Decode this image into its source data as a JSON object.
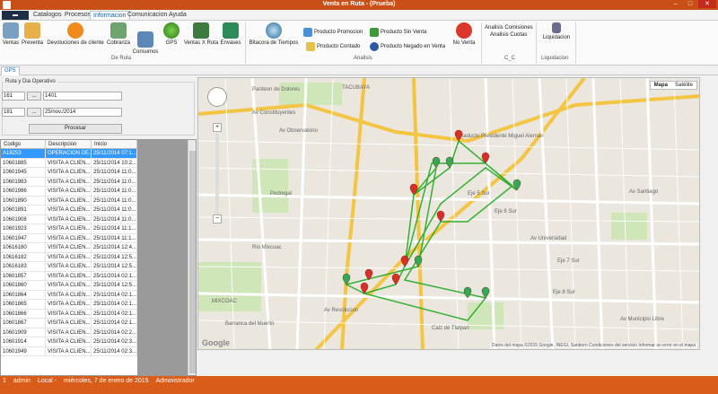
{
  "window": {
    "title": "Venta en Ruta - (Prueba)"
  },
  "menu": {
    "items": [
      "Catalogos",
      "Procesos",
      "Informacion",
      "Comunicacion",
      "Ayuda"
    ],
    "active": "Informacion"
  },
  "ribbon": {
    "ruta_buttons": [
      "Ventas",
      "Preventa",
      "Devoluciones de cliente",
      "Cobranza",
      "Consumos",
      "GPS",
      "Ventas X Ruta",
      "Envases"
    ],
    "ruta_group": "De Ruta",
    "analisis": {
      "bitacora": "Bitacora de Tiempos",
      "promocion": "Producto Promocion",
      "contado": "Producto Contado",
      "sin_venta": "Producto Sin Venta",
      "negado": "Producto Negado en Venta",
      "no_venta": "No Venta",
      "group": "Analisis"
    },
    "cc": {
      "comisiones": "Analisis Comisiones",
      "cuotas": "Analisis Cuotas",
      "group": "C_C"
    },
    "liq": {
      "label": "Liquidacion",
      "group": "Liquidacion"
    }
  },
  "tab": "GPS",
  "filters": {
    "group_title": "Ruta y Dia Operativo",
    "ruta_code": "161",
    "ruta_value": "1401",
    "dia_code": "181",
    "dia_value": "25/nov./2014",
    "ellipsis": "...",
    "process_button": "Procesar"
  },
  "grid": {
    "headers": [
      "Codigo",
      "Descripcion",
      "Inicio"
    ],
    "rows": [
      [
        "A18253",
        "OPERACION DE...",
        "25/11/2014 07:1..."
      ],
      [
        "10601885",
        "VISITA A CLIEN...",
        "25/11/2014 10:2..."
      ],
      [
        "10601945",
        "VISITA A CLIEN...",
        "25/11/2014 11:0..."
      ],
      [
        "10601983",
        "VISITA A CLIEN...",
        "25/11/2014 11:0..."
      ],
      [
        "10601986",
        "VISITA A CLIEN...",
        "25/11/2014 11:0..."
      ],
      [
        "10601890",
        "VISITA A CLIEN...",
        "25/11/2014 11:0..."
      ],
      [
        "10601891",
        "VISITA A CLIEN...",
        "25/11/2014 11:0..."
      ],
      [
        "10601908",
        "VISITA A CLIEN...",
        "25/11/2014 11:0..."
      ],
      [
        "10601923",
        "VISITA A CLIEN...",
        "25/11/2014 11:1..."
      ],
      [
        "10601947",
        "VISITA A CLIEN...",
        "25/11/2014 11:1..."
      ],
      [
        "10616180",
        "VISITA A CLIEN...",
        "25/11/2014 12:4..."
      ],
      [
        "10616182",
        "VISITA A CLIEN...",
        "25/11/2014 12:5..."
      ],
      [
        "10616183",
        "VISITA A CLIEN...",
        "25/11/2014 12:5..."
      ],
      [
        "10601857",
        "VISITA A CLIEN...",
        "25/11/2014 02:1..."
      ],
      [
        "10601860",
        "VISITA A CLIEN...",
        "25/11/2014 12:5..."
      ],
      [
        "10601864",
        "VISITA A CLIEN...",
        "25/11/2014 02:1..."
      ],
      [
        "10601865",
        "VISITA A CLIEN...",
        "25/11/2014 02:1..."
      ],
      [
        "10601866",
        "VISITA A CLIEN...",
        "25/11/2014 02:1..."
      ],
      [
        "10601867",
        "VISITA A CLIEN...",
        "25/11/2014 02:1..."
      ],
      [
        "10601909",
        "VISITA A CLIEN...",
        "25/11/2014 02:2..."
      ],
      [
        "10601914",
        "VISITA A CLIEN...",
        "25/11/2014 02:3..."
      ],
      [
        "10601949",
        "VISITA A CLIEN...",
        "25/11/2014 02:3..."
      ]
    ]
  },
  "map": {
    "type_buttons": [
      "Mapa",
      "Satélite"
    ],
    "copyright": "Datos del mapa ©2015 Google, INEGI, Sanborn   Condiciones del servicio   Informar un error en el mapa",
    "google": "Google",
    "streets": [
      "Panteon de Dolores",
      "TACUBAYA",
      "Av Constituyentes",
      "Av Observatorio",
      "Viaducto Presidente Miguel Aleman",
      "Eje 5 Sur",
      "Eje 6 Sur",
      "Av Santiago",
      "Eje 7 Sur",
      "Av Municipio Libre",
      "Rio Mixcoac",
      "MIXCOAC",
      "Barranca del Muerto",
      "Av Revolucion",
      "Pedregal",
      "Av Universidad",
      "Eje 8 Sur",
      "Calz de Tlalpan"
    ],
    "colors": {
      "route": "#22aa22",
      "marker_red": "#d93025",
      "marker_green": "#34a853"
    }
  },
  "status": {
    "num": "1",
    "user": "admin",
    "mode": "Local -",
    "date": "miércoles, 7 de enero de 2015",
    "role": "Administrador"
  }
}
